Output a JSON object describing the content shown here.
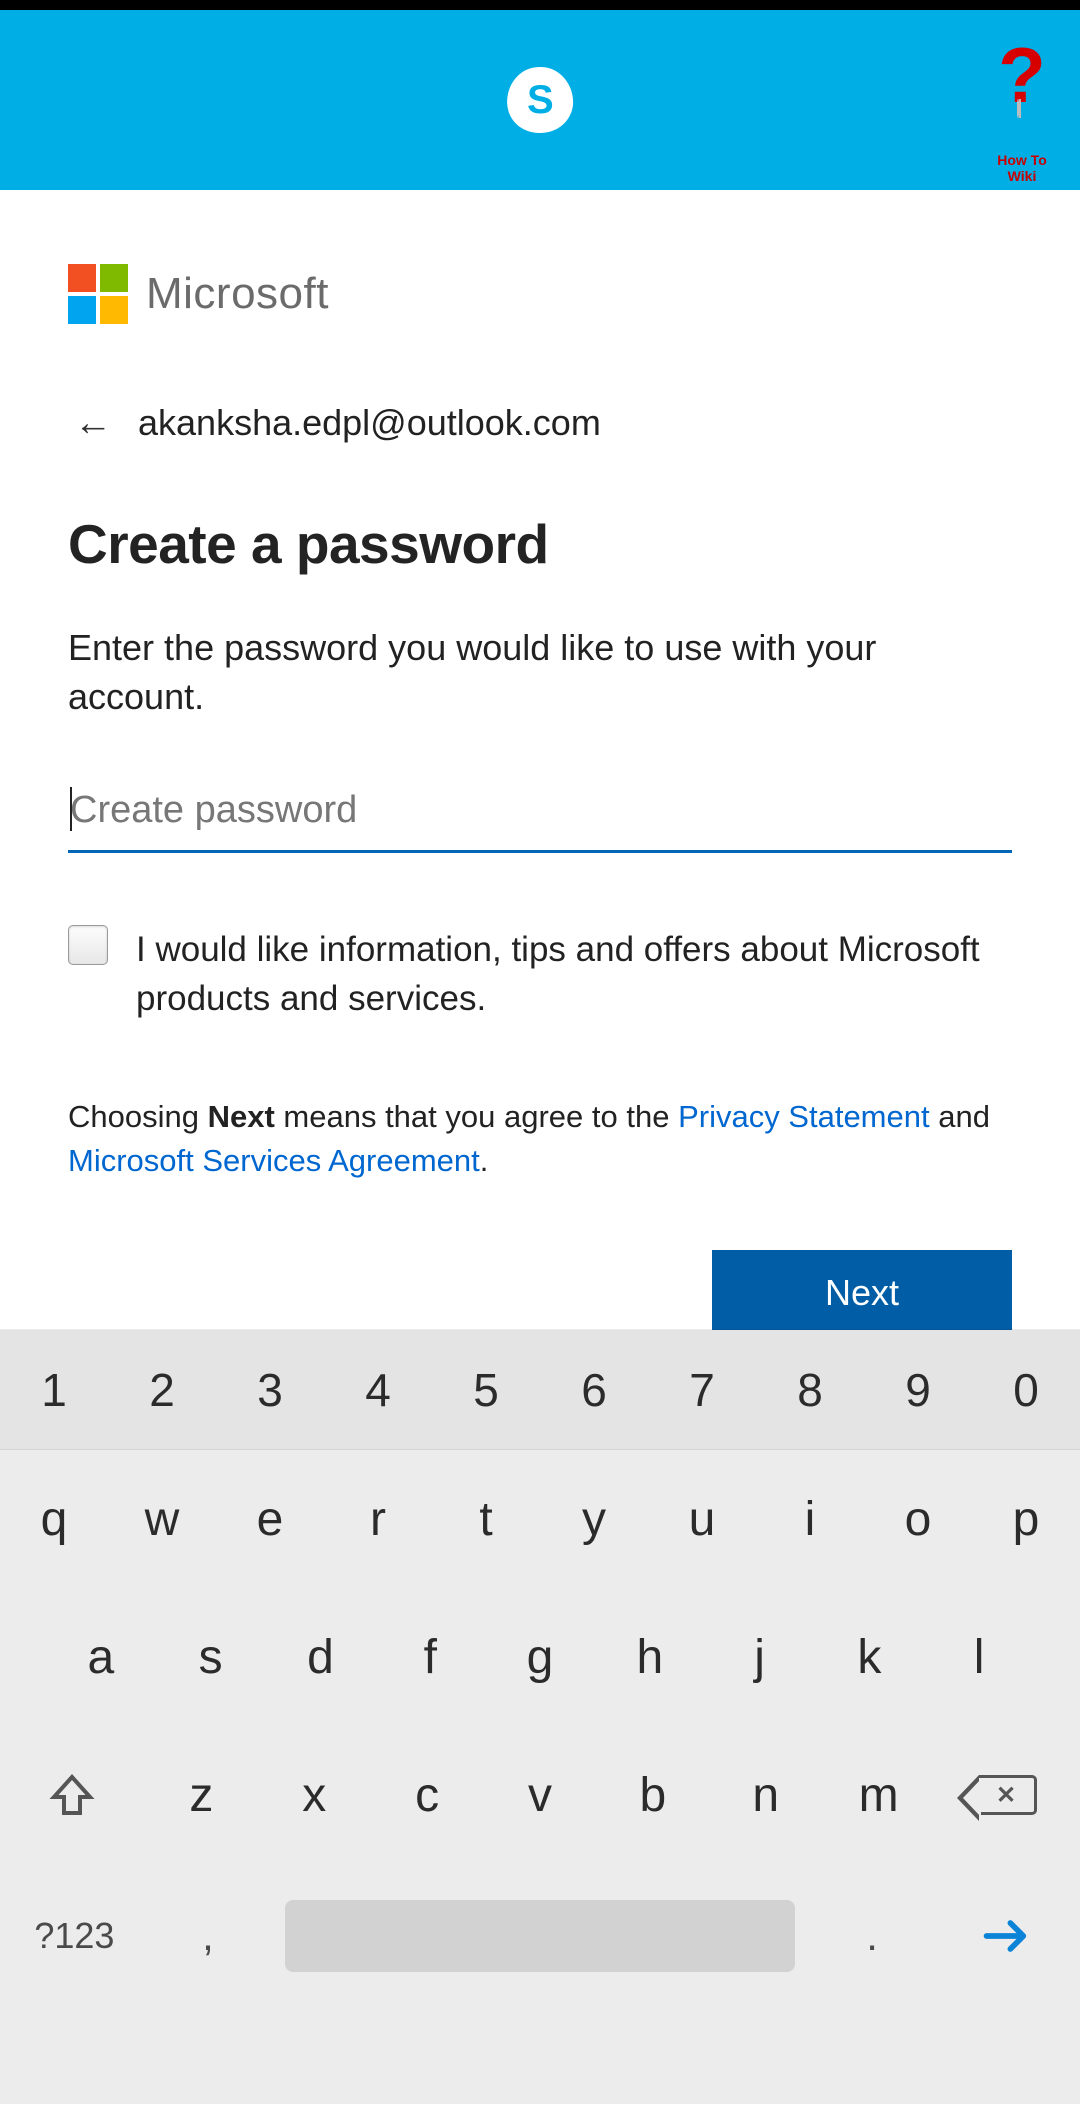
{
  "header": {
    "skype_letter": "S",
    "howto_label": "How To Wiki"
  },
  "brand": {
    "name": "Microsoft"
  },
  "account": {
    "email": "akanksha.edpl@outlook.com"
  },
  "page": {
    "title": "Create a password",
    "subtitle": "Enter the password you would like to use with your account.",
    "password_placeholder": "Create password",
    "checkbox_label": "I would like information, tips and offers about Microsoft products and services.",
    "legal_prefix": "Choosing ",
    "legal_next": "Next",
    "legal_mid": " means that you agree to the ",
    "legal_privacy": "Privacy Statement",
    "legal_and": " and ",
    "legal_msa": "Microsoft Services Agreement",
    "legal_period": ".",
    "next_button": "Next"
  },
  "keyboard": {
    "numbers": [
      "1",
      "2",
      "3",
      "4",
      "5",
      "6",
      "7",
      "8",
      "9",
      "0"
    ],
    "row1": [
      "q",
      "w",
      "e",
      "r",
      "t",
      "y",
      "u",
      "i",
      "o",
      "p"
    ],
    "row2": [
      "a",
      "s",
      "d",
      "f",
      "g",
      "h",
      "j",
      "k",
      "l"
    ],
    "row3": [
      "z",
      "x",
      "c",
      "v",
      "b",
      "n",
      "m"
    ],
    "symbols_key": "?123",
    "comma": ",",
    "dot": "."
  }
}
